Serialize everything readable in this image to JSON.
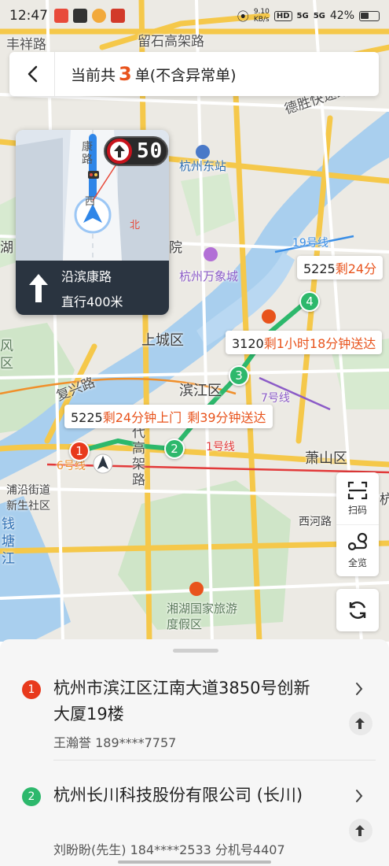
{
  "status_bar": {
    "time": "12:47",
    "net_speed_value": "9.10",
    "net_speed_unit": "KB/s",
    "hd_tag": "HD",
    "signal_1": "5G",
    "signal_2": "5G",
    "battery": "42%"
  },
  "header": {
    "back_icon": "chevron-left-icon",
    "title_prefix": "当前共",
    "count": "3",
    "title_suffix": "单(不含异常单)"
  },
  "navigation": {
    "speed_limit": "50",
    "instruction_road": "沿滨康路",
    "instruction_distance": "直行400米",
    "view_labels": [
      "康路",
      "西",
      "北"
    ]
  },
  "map_labels": {
    "roads": [
      "丰祥路",
      "留石高架路",
      "德胜快速路",
      "复兴路",
      "代高架路",
      "1号线",
      "6号线",
      "7号线",
      "19号线"
    ],
    "places": [
      "杭州东站",
      "杭州万象城",
      "湖",
      "上城区",
      "滨江区",
      "萧山区",
      "西河路",
      "浦沿街道",
      "新生社区",
      "钱塘江",
      "湘湖国家旅游度假区",
      "风",
      "区",
      "院",
      "杭"
    ]
  },
  "route_tags": [
    {
      "code": "5225",
      "text": "剩24分"
    },
    {
      "code": "3120",
      "text": "剩1小时18分钟送达"
    },
    {
      "code": "5225",
      "text": "剩24分钟上门"
    },
    {
      "code": "",
      "text": "剩39分钟送达"
    }
  ],
  "stops": [
    "1",
    "2",
    "3",
    "4"
  ],
  "float_buttons": {
    "scan_label": "扫码",
    "overview_label": "全览"
  },
  "orders": [
    {
      "num": "1",
      "address": "杭州市滨江区江南大道3850号创新大厦19楼",
      "contact": "王瀚誉 189****7757"
    },
    {
      "num": "2",
      "address": "杭州长川科技股份有限公司 (长川)",
      "contact": "刘盼盼(先生) 184****2533 分机号4407"
    }
  ],
  "colors": {
    "accent": "#e8531c",
    "route_green": "#2db86c",
    "stop_red": "#e8391c",
    "road_yellow": "#f5c84a",
    "water": "#a9cfee",
    "park": "#cfe5c8"
  }
}
